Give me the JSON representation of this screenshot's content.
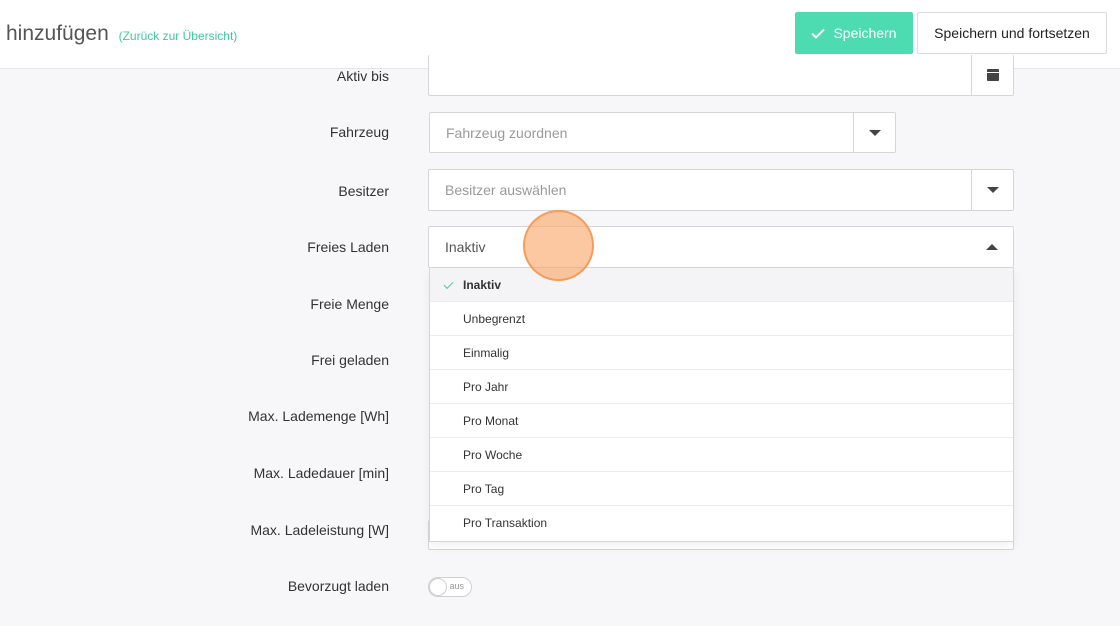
{
  "header": {
    "title": "hinzufügen",
    "back_link": "(Zurück zur Übersicht)",
    "save_label": "Speichern",
    "save_continue_label": "Speichern und fortsetzen"
  },
  "form": {
    "aktiv_bis": {
      "label": "Aktiv bis",
      "value": ""
    },
    "fahrzeug": {
      "label": "Fahrzeug",
      "placeholder": "Fahrzeug zuordnen"
    },
    "besitzer": {
      "label": "Besitzer",
      "placeholder": "Besitzer auswählen"
    },
    "freies_laden": {
      "label": "Freies Laden",
      "value": "Inaktiv",
      "options": [
        "Inaktiv",
        "Unbegrenzt",
        "Einmalig",
        "Pro Jahr",
        "Pro Monat",
        "Pro Woche",
        "Pro Tag",
        "Pro Transaktion"
      ],
      "selected": "Inaktiv"
    },
    "freie_menge": {
      "label": "Freie Menge"
    },
    "frei_geladen": {
      "label": "Frei geladen"
    },
    "max_lademenge": {
      "label": "Max. Lademenge [Wh]"
    },
    "max_ladedauer": {
      "label": "Max. Ladedauer [min]"
    },
    "max_ladeleistung": {
      "label": "Max. Ladeleistung [W]"
    },
    "bevorzugt_laden": {
      "label": "Bevorzugt laden",
      "toggle_text": "aus"
    }
  },
  "icons": {
    "save": "check-icon",
    "date": "calendar-icon",
    "select": "chevron-down-icon",
    "select_open": "chevron-up-icon"
  },
  "colors": {
    "accent": "#4ddbb2",
    "link": "#3cc9a0",
    "cursor": "#f9aa6e"
  }
}
